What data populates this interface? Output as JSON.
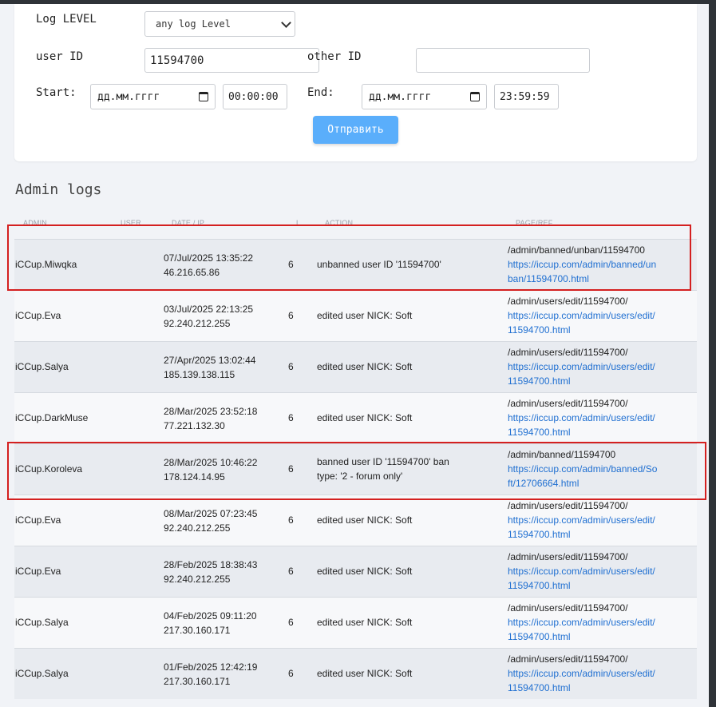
{
  "form": {
    "log_level_label": "Log LEVEL",
    "log_level_value": "any log Level",
    "user_id_label": "user ID",
    "user_id_value": "11594700",
    "other_id_label": "other ID",
    "other_id_value": "",
    "start_label": "Start:",
    "start_date_placeholder": "дд.мм.гггг",
    "start_time": "00:00:00",
    "end_label": "End:",
    "end_date_placeholder": "дд.мм.гггг",
    "end_time": "23:59:59",
    "submit_label": "Отправить"
  },
  "section_title": "Admin logs",
  "columns": [
    "ADMIN",
    "USER",
    "DATE / IP",
    "L",
    "ACTION",
    "PAGE/REF"
  ],
  "rows": [
    {
      "admin": "iCCup.Miwqka",
      "date": "07/Jul/2025 13:35:22",
      "ip": "46.216.65.86",
      "level": "6",
      "action": "unbanned user ID '11594700'",
      "page": "/admin/banned/unban/11594700",
      "ref": "https://iccup.com/admin/banned/unban/11594700.html"
    },
    {
      "admin": "iCCup.Eva",
      "date": "03/Jul/2025 22:13:25",
      "ip": "92.240.212.255",
      "level": "6",
      "action": "edited user NICK: Soft",
      "page": "/admin/users/edit/11594700/",
      "ref": "https://iccup.com/admin/users/edit/11594700.html"
    },
    {
      "admin": "iCCup.Salya",
      "date": "27/Apr/2025 13:02:44",
      "ip": "185.139.138.115",
      "level": "6",
      "action": "edited user NICK: Soft",
      "page": "/admin/users/edit/11594700/",
      "ref": "https://iccup.com/admin/users/edit/11594700.html"
    },
    {
      "admin": "iCCup.DarkMuse",
      "date": "28/Mar/2025 23:52:18",
      "ip": "77.221.132.30",
      "level": "6",
      "action": "edited user NICK: Soft",
      "page": "/admin/users/edit/11594700/",
      "ref": "https://iccup.com/admin/users/edit/11594700.html"
    },
    {
      "admin": "iCCup.Koroleva",
      "date": "28/Mar/2025 10:46:22",
      "ip": "178.124.14.95",
      "level": "6",
      "action": "banned user ID '11594700' ban type: '2 - forum only'",
      "page": "/admin/banned/11594700",
      "ref": "https://iccup.com/admin/banned/Soft/12706664.html"
    },
    {
      "admin": "iCCup.Eva",
      "date": "08/Mar/2025 07:23:45",
      "ip": "92.240.212.255",
      "level": "6",
      "action": "edited user NICK: Soft",
      "page": "/admin/users/edit/11594700/",
      "ref": "https://iccup.com/admin/users/edit/11594700.html"
    },
    {
      "admin": "iCCup.Eva",
      "date": "28/Feb/2025 18:38:43",
      "ip": "92.240.212.255",
      "level": "6",
      "action": "edited user NICK: Soft",
      "page": "/admin/users/edit/11594700/",
      "ref": "https://iccup.com/admin/users/edit/11594700.html"
    },
    {
      "admin": "iCCup.Salya",
      "date": "04/Feb/2025 09:11:20",
      "ip": "217.30.160.171",
      "level": "6",
      "action": "edited user NICK: Soft",
      "page": "/admin/users/edit/11594700/",
      "ref": "https://iccup.com/admin/users/edit/11594700.html"
    },
    {
      "admin": "iCCup.Salya",
      "date": "01/Feb/2025 12:42:19",
      "ip": "217.30.160.171",
      "level": "6",
      "action": "edited user NICK: Soft",
      "page": "/admin/users/edit/11594700/",
      "ref": "https://iccup.com/admin/users/edit/11594700.html"
    }
  ],
  "colors": {
    "accent": "#5aaefb",
    "link": "#1f6fd1",
    "highlight": "#d42020"
  }
}
